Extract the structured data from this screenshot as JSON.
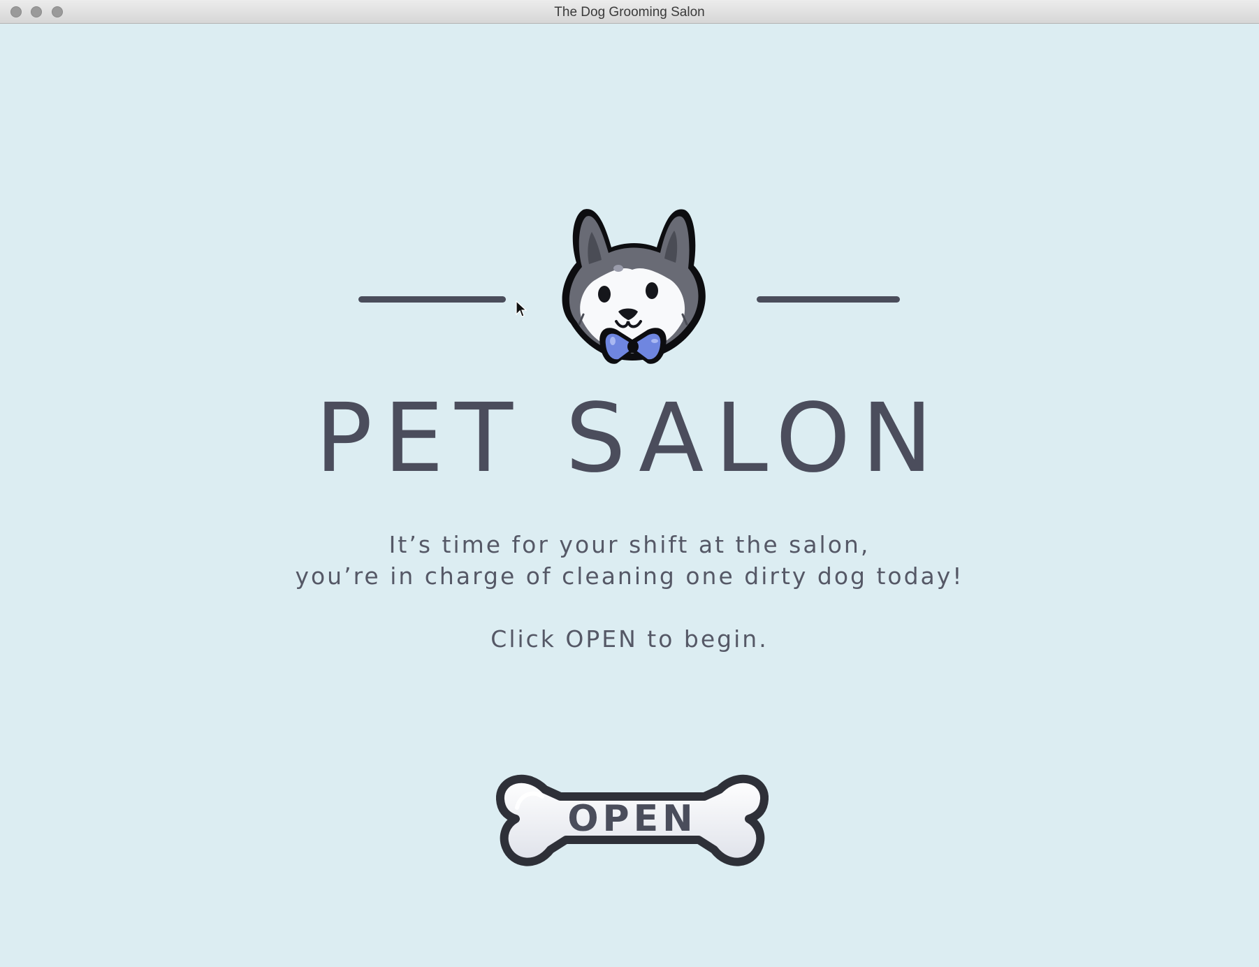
{
  "window": {
    "title": "The Dog Grooming Salon"
  },
  "screen": {
    "title": "PET SALON",
    "intro_line1": "It’s time for your shift at the salon,",
    "intro_line2": "you’re in charge of cleaning one dirty dog today!",
    "instruction": "Click OPEN to begin.",
    "open_button_label": "OPEN",
    "logo_icon": "husky-dog-with-bowtie-icon",
    "button_icon": "bone-icon"
  },
  "colors": {
    "background": "#dcedf2",
    "text": "#4b4d5c",
    "bowtie": "#6f86e0"
  }
}
